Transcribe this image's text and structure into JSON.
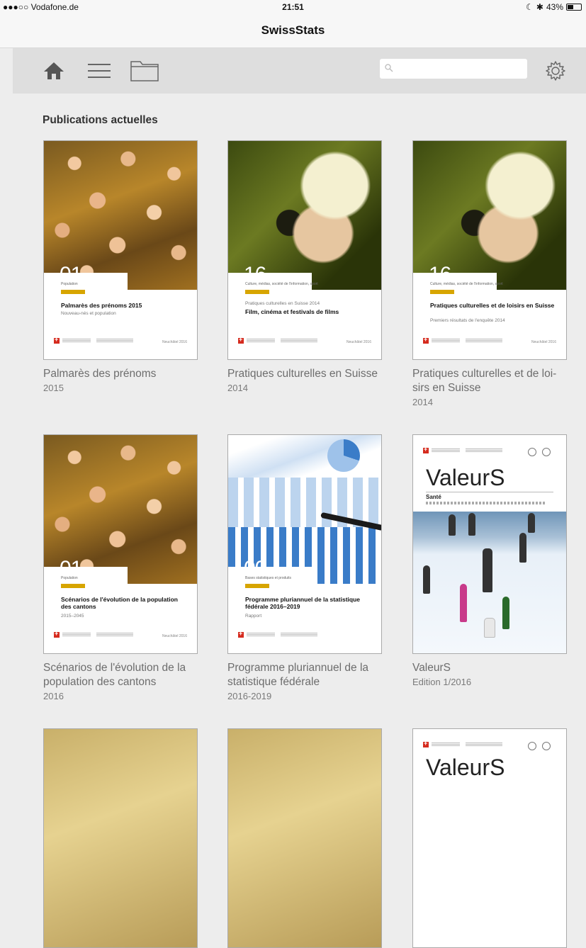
{
  "status": {
    "carrier": "●●●○○ Vodafone.de",
    "time": "21:51",
    "battery": "43%"
  },
  "app": {
    "title": "SwissStats"
  },
  "toolbar": {
    "icons": [
      "home-icon",
      "menu-icon",
      "folder-icon",
      "search-icon",
      "gear-icon"
    ],
    "search_placeholder": ""
  },
  "section": {
    "title": "Publications actuelles"
  },
  "publications": [
    {
      "label": "Palmarès des prénoms",
      "year": "2015",
      "cover_number": "01",
      "cover_category": "Population",
      "cover_title": "Palmarès des prénoms 2015",
      "cover_subtitle": "Nouveau-nés et population",
      "cover_date": "Neuchâtel 2016"
    },
    {
      "label": "Pratiques culturelles en Suisse",
      "year": "2014",
      "cover_number": "16",
      "cover_category": "Culture, médias, société de l'information, sport",
      "cover_pretitle": "Pratiques culturelles en Suisse 2014",
      "cover_title": "Film, cinéma et festivals de films",
      "cover_date": "Neuchâtel 2016"
    },
    {
      "label": "Pratiques culturelles et de loi-sirs en Suisse",
      "year": "2014",
      "cover_number": "16",
      "cover_category": "Culture, médias, société de l'information, sport",
      "cover_title": "Pratiques culturelles et de loisirs en Suisse",
      "cover_subtitle": "Premiers résultats de l'enquête 2014",
      "cover_date": "Neuchâtel 2016"
    },
    {
      "label": "Scénarios de l'évolution de la population des cantons",
      "year": "2016",
      "cover_number": "01",
      "cover_category": "Population",
      "cover_title": "Scénarios de l'évolution de la population des cantons",
      "cover_subtitle": "2015–2045",
      "cover_date": "Neuchâtel 2016"
    },
    {
      "label": "Programme pluriannuel de la statistique fédérale",
      "year": "2016-2019",
      "cover_number": "00",
      "cover_category": "Bases statistiques et produits",
      "cover_title": "Programme pluriannuel de la statistique fédérale 2016–2019",
      "cover_subtitle": "Rapport"
    },
    {
      "label": "ValeurS",
      "year": "Edition 1/2016",
      "cover_title": "ValeurS",
      "cover_subtitle": "Santé"
    }
  ],
  "partial_row": [
    {
      "cover_title": ""
    },
    {
      "cover_title": ""
    },
    {
      "cover_title": "ValeurS"
    }
  ]
}
